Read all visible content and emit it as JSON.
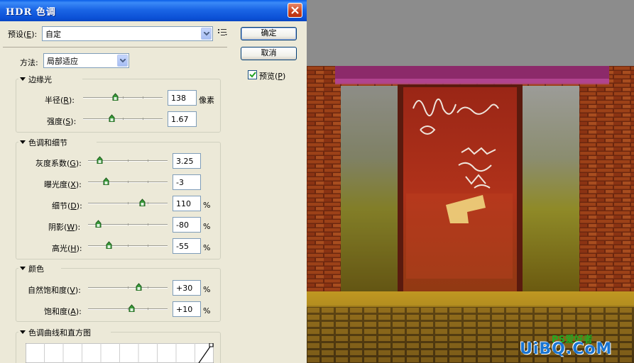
{
  "dialog": {
    "title": "HDR 色调",
    "preset": {
      "label": "预设(E):",
      "label_main": "预设(",
      "label_key": "E",
      "label_tail": "):",
      "value": "自定"
    },
    "buttons": {
      "ok": "确定",
      "cancel": "取消"
    },
    "preview": {
      "label_main": "预览(",
      "label_key": "P",
      "label_tail": ")",
      "checked": true
    },
    "method": {
      "label": "方法:",
      "value": "局部适应"
    },
    "edge_glow": {
      "title": "边缘光",
      "radius": {
        "label_main": "半径(",
        "key": "R",
        "tail": "):",
        "value": "138",
        "unit": "像素",
        "level": 0.4
      },
      "strength": {
        "label_main": "强度(",
        "key": "S",
        "tail": "):",
        "value": "1.67",
        "level": 0.35
      }
    },
    "tone_detail": {
      "title": "色调和细节",
      "gamma": {
        "label_main": "灰度系数(",
        "key": "G",
        "tail": "):",
        "value": "3.25",
        "level": 0.12
      },
      "exposure": {
        "label_main": "曝光度(",
        "key": "X",
        "tail": "):",
        "value": "-3",
        "level": 0.2
      },
      "detail": {
        "label_main": "细节(",
        "key": "D",
        "tail": "):",
        "value": "110",
        "unit": "%",
        "level": 0.7
      },
      "shadow": {
        "label_main": "阴影(",
        "key": "W",
        "tail": "):",
        "value": "-80",
        "unit": "%",
        "level": 0.1
      },
      "highlight": {
        "label_main": "高光(",
        "key": "H",
        "tail": "):",
        "value": "-55",
        "unit": "%",
        "level": 0.24
      }
    },
    "color": {
      "title": "颜色",
      "vibrance": {
        "label_main": "自然饱和度(",
        "key": "V",
        "tail": "):",
        "value": "+30",
        "unit": "%",
        "level": 0.65
      },
      "saturation": {
        "label_main": "饱和度(",
        "key": "A",
        "tail": "):",
        "value": "+10",
        "unit": "%",
        "level": 0.55
      }
    },
    "curve": {
      "title": "色调曲线和直方图"
    }
  },
  "watermark": {
    "text": "UiBQ.CoM",
    "badge": "PS爱好者"
  },
  "colors": {
    "title_bar": "#1b66e6",
    "dialog_bg": "#ece9d8",
    "slider_thumb": "#3a9c3a",
    "watermark": "#1a75d2"
  },
  "icons": {
    "close": "close-icon",
    "preset_menu": "list-menu-icon",
    "dropdown": "chevron-down-icon",
    "check": "checkmark-icon"
  }
}
